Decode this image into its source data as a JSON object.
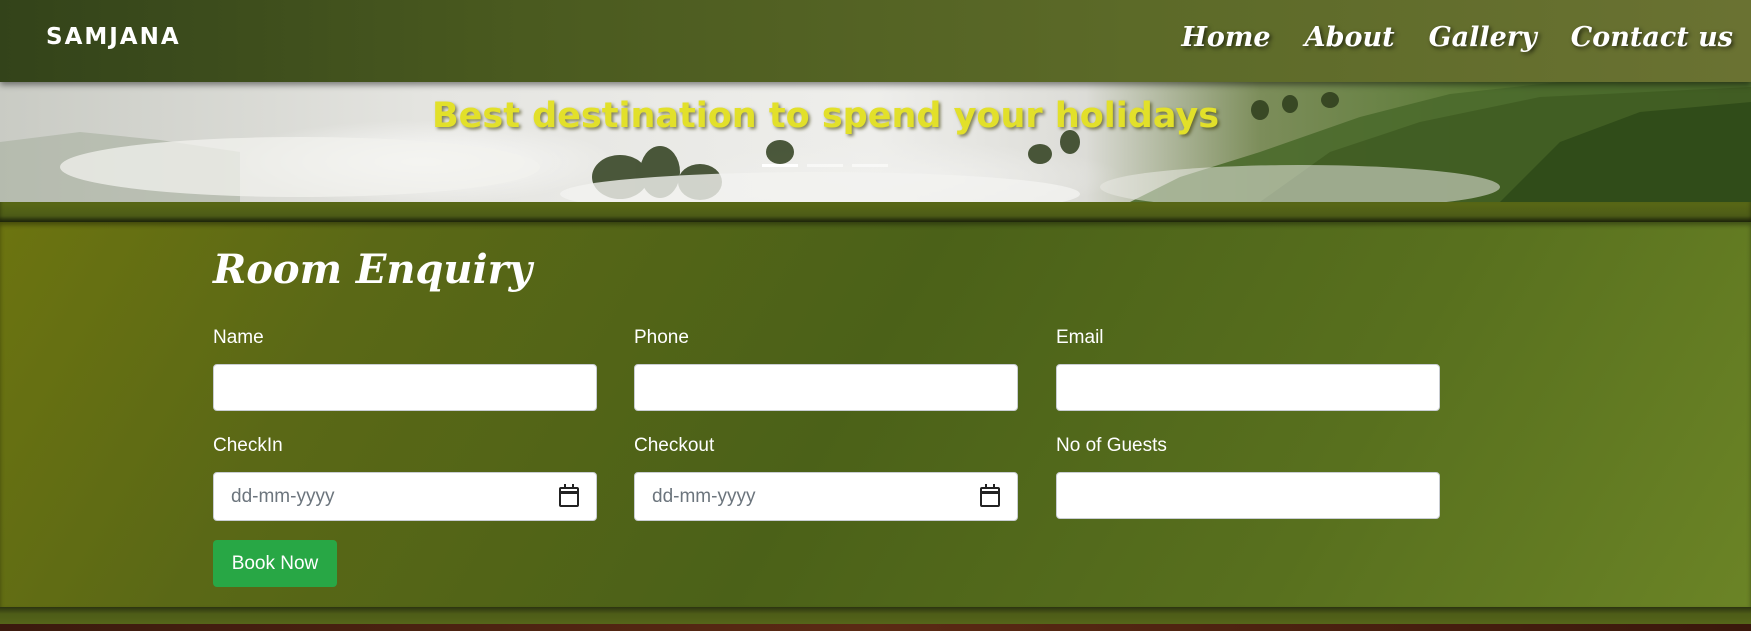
{
  "navbar": {
    "brand": "SAMJANA",
    "links": [
      "Home",
      "About",
      "Gallery",
      "Contact us"
    ]
  },
  "hero": {
    "title": "Best destination to spend your holidays",
    "slide_count": 3,
    "active_slide": 1
  },
  "enquiry": {
    "title": "Room Enquiry",
    "fields": {
      "name": {
        "label": "Name",
        "value": ""
      },
      "phone": {
        "label": "Phone",
        "value": ""
      },
      "email": {
        "label": "Email",
        "value": ""
      },
      "checkin": {
        "label": "CheckIn",
        "placeholder": "dd-mm-yyyy"
      },
      "checkout": {
        "label": "Checkout",
        "placeholder": "dd-mm-yyyy"
      },
      "guests": {
        "label": "No of Guests",
        "value": ""
      }
    },
    "submit_label": "Book Now"
  },
  "colors": {
    "nav_bg": "#4a5a1f",
    "hero_title": "#e2e02a",
    "section_bg": "#55681a",
    "button": "#28a745"
  },
  "icons": {
    "date_picker": "calendar-icon"
  }
}
